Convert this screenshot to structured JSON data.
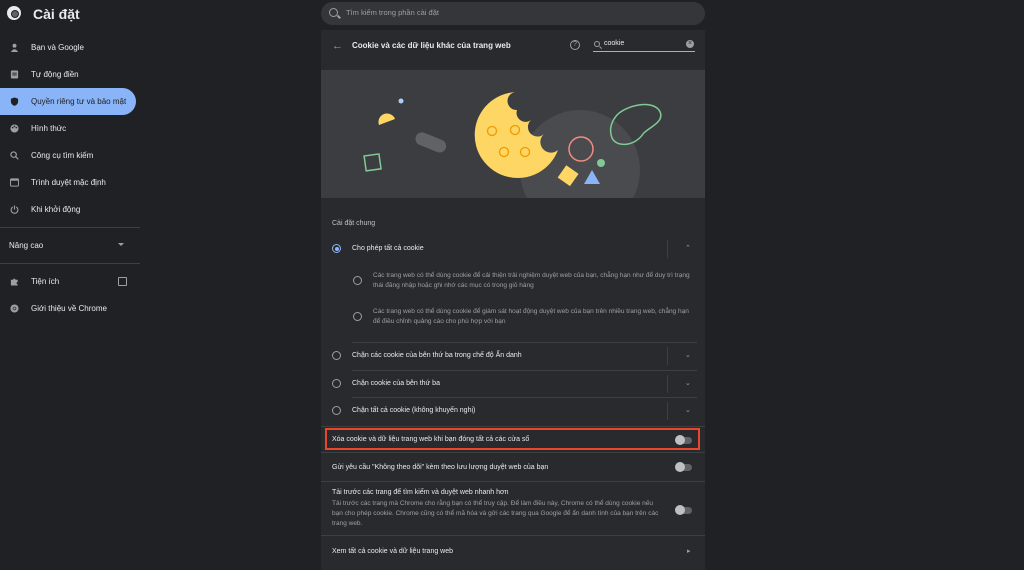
{
  "app": {
    "title": "Cài đặt"
  },
  "search": {
    "placeholder": "Tìm kiếm trong phần cài đặt"
  },
  "sidebar": {
    "items": [
      {
        "label": "Bạn và Google",
        "icon": "person-icon"
      },
      {
        "label": "Tự động điền",
        "icon": "clipboard-icon"
      },
      {
        "label": "Quyền riêng tư và bảo mật",
        "icon": "shield-icon",
        "active": true
      },
      {
        "label": "Hình thức",
        "icon": "palette-icon"
      },
      {
        "label": "Công cụ tìm kiếm",
        "icon": "search-icon"
      },
      {
        "label": "Trình duyệt mặc định",
        "icon": "browser-icon"
      },
      {
        "label": "Khi khởi động",
        "icon": "power-icon"
      }
    ],
    "advanced_label": "Nâng cao",
    "extensions_label": "Tiện ích",
    "about_label": "Giới thiệu về Chrome"
  },
  "panel": {
    "title": "Cookie và các dữ liệu khác của trang web",
    "filter_value": "cookie",
    "section_label": "Cài đặt chung",
    "options": [
      {
        "label": "Cho phép tất cả cookie",
        "checked": true,
        "expanded": true
      },
      {
        "label": "Chặn các cookie của bên thứ ba trong chế độ Ẩn danh",
        "checked": false
      },
      {
        "label": "Chặn cookie của bên thứ ba",
        "checked": false
      },
      {
        "label": "Chặn tất cả cookie (không khuyến nghị)",
        "checked": false
      }
    ],
    "descriptions": [
      "Các trang web có thể dùng cookie để cải thiện trải nghiệm duyệt web của bạn, chẳng hạn như để duy trì trạng thái đăng nhập hoặc ghi nhớ các mục có trong giỏ hàng",
      "Các trang web có thể dùng cookie để giám sát hoạt động duyệt web của bạn trên nhiều trang web, chẳng hạn để điều chỉnh quảng cáo cho phù hợp với bạn"
    ],
    "toggles": [
      {
        "label": "Xóa cookie và dữ liệu trang web khi bạn đóng tất cả các cửa sổ",
        "on": false,
        "highlighted": true
      },
      {
        "label": "Gửi yêu cầu \"Không theo dõi\" kèm theo lưu lượng duyệt web của bạn",
        "on": false
      }
    ],
    "prefetch": {
      "title": "Tải trước các trang để tìm kiếm và duyệt web nhanh hơn",
      "description": "Tải trước các trang mà Chrome cho rằng bạn có thể truy cập. Để làm điều này, Chrome có thể dùng cookie nếu bạn cho phép cookie. Chrome cũng có thể mã hóa và gửi các trang qua Google để ẩn danh tính của bạn trên các trang web.",
      "on": false
    },
    "see_all_label": "Xem tất cả cookie và dữ liệu trang web"
  },
  "colors": {
    "accent": "#8ab4f8",
    "highlight": "#e8472b",
    "background": "#202124",
    "panel": "#292a2d"
  }
}
